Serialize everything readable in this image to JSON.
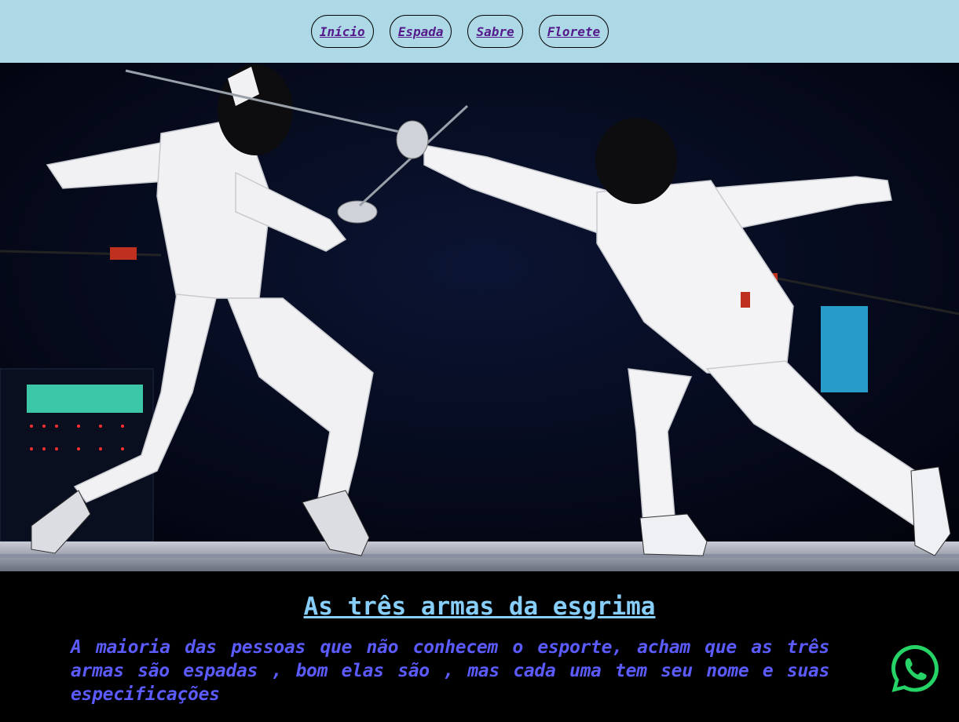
{
  "nav": {
    "items": [
      {
        "label": "Início"
      },
      {
        "label": "Espada"
      },
      {
        "label": "Sabre"
      },
      {
        "label": "Florete"
      }
    ]
  },
  "hero": {
    "icon": "fencing-photo"
  },
  "main": {
    "title": "As três armas da esgrima",
    "description": "A maioria das pessoas que não conhecem o esporte, acham que as três armas são espadas , bom elas são , mas cada uma tem seu nome e suas especificações"
  },
  "whatsapp": {
    "icon": "whatsapp-icon",
    "color": "#25d366"
  },
  "colors": {
    "nav_bg": "#add8e6",
    "link": "#551a8b",
    "title": "#87cefa",
    "text": "#5b5bff"
  }
}
